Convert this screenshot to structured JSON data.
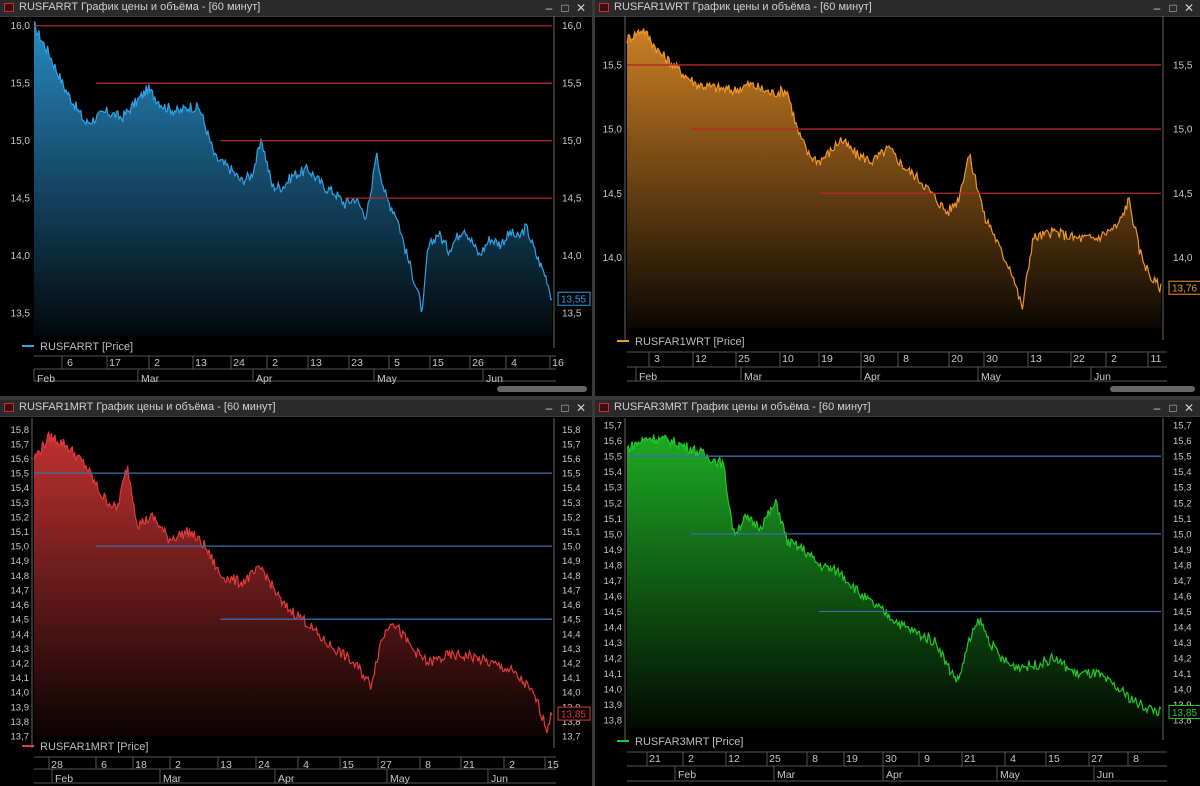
{
  "windows": [
    {
      "title": "RUSFARRT График цены и объёма - [60 минут]",
      "legend": "RUSFARRT [Price]",
      "color": "#2ea3e6",
      "last_label": "13,55",
      "chart_data": {
        "type": "area",
        "ylim": [
          13.3,
          16.05
        ],
        "y_ticks": [
          "13,5",
          "14,0",
          "14,5",
          "15,0",
          "15,5",
          "16,0"
        ],
        "y_tick_values": [
          13.5,
          14.0,
          14.5,
          15.0,
          15.5,
          16.0
        ],
        "x": [
          0,
          0.03,
          0.06,
          0.1,
          0.14,
          0.17,
          0.2,
          0.22,
          0.25,
          0.28,
          0.3,
          0.32,
          0.35,
          0.38,
          0.4,
          0.42,
          0.44,
          0.46,
          0.48,
          0.5,
          0.53,
          0.56,
          0.58,
          0.6,
          0.62,
          0.64,
          0.65,
          0.66,
          0.68,
          0.7,
          0.72,
          0.74,
          0.75,
          0.76,
          0.78,
          0.8,
          0.83,
          0.86,
          0.88,
          0.9,
          0.92,
          0.935,
          0.95,
          0.97,
          0.99,
          1
        ],
        "values": [
          16.0,
          15.75,
          15.45,
          15.15,
          15.25,
          15.2,
          15.35,
          15.45,
          15.3,
          15.25,
          15.3,
          15.28,
          14.85,
          14.75,
          14.65,
          14.7,
          15.0,
          14.6,
          14.6,
          14.7,
          14.75,
          14.6,
          14.55,
          14.45,
          14.5,
          14.35,
          14.5,
          14.9,
          14.5,
          14.35,
          14.0,
          13.7,
          13.5,
          14.05,
          14.2,
          14.05,
          14.25,
          14.0,
          14.15,
          14.1,
          14.2,
          14.15,
          14.25,
          14.0,
          13.8,
          13.62
        ],
        "ref_lines": [
          16.0,
          15.5,
          15.0,
          14.5
        ],
        "ref_color": "#b52828",
        "x_ticks_top": [
          "6",
          "17",
          "2",
          "13",
          "24",
          "2",
          "13",
          "23",
          "5",
          "15",
          "26",
          "4",
          "16"
        ],
        "x_ticks_bottom": [
          "Feb",
          "Mar",
          "Apr",
          "May",
          "Jun"
        ]
      }
    },
    {
      "title": "RUSFAR1WRT График цены и объёма - [60 минут]",
      "legend": "RUSFAR1WRT [Price]",
      "color": "#f0962a",
      "last_label": "13,76",
      "chart_data": {
        "type": "area",
        "ylim": [
          13.45,
          15.85
        ],
        "y_ticks": [
          "14,0",
          "14,5",
          "15,0",
          "15,5"
        ],
        "y_tick_values": [
          14.0,
          14.5,
          15.0,
          15.5
        ],
        "x": [
          0,
          0.03,
          0.06,
          0.1,
          0.13,
          0.17,
          0.2,
          0.23,
          0.27,
          0.3,
          0.32,
          0.34,
          0.36,
          0.38,
          0.4,
          0.43,
          0.46,
          0.49,
          0.52,
          0.55,
          0.58,
          0.6,
          0.62,
          0.64,
          0.66,
          0.67,
          0.68,
          0.7,
          0.72,
          0.74,
          0.76,
          0.8,
          0.84,
          0.88,
          0.9,
          0.92,
          0.94,
          0.96,
          0.98,
          1
        ],
        "values": [
          15.7,
          15.78,
          15.6,
          15.45,
          15.35,
          15.32,
          15.3,
          15.35,
          15.28,
          15.3,
          14.98,
          14.8,
          14.75,
          14.82,
          14.92,
          14.8,
          14.75,
          14.85,
          14.7,
          14.6,
          14.45,
          14.35,
          14.45,
          14.8,
          14.5,
          14.3,
          14.25,
          14.05,
          13.9,
          13.6,
          14.15,
          14.2,
          14.15,
          14.15,
          14.2,
          14.25,
          14.45,
          14.05,
          13.85,
          13.76
        ],
        "ref_lines": [
          15.5,
          15.0,
          14.5
        ],
        "ref_color": "#b52828",
        "x_ticks_top": [
          "3",
          "12",
          "25",
          "10",
          "19",
          "30",
          "8",
          "20",
          "30",
          "13",
          "22",
          "2",
          "11"
        ],
        "x_ticks_bottom": [
          "Feb",
          "Mar",
          "Apr",
          "May",
          "Jun"
        ]
      }
    },
    {
      "title": "RUSFAR1MRT График цены и объёма - [60 минут]",
      "legend": "RUSFAR1MRT [Price]",
      "color": "#e23a3a",
      "last_label": "13,85",
      "chart_data": {
        "type": "area",
        "ylim": [
          13.7,
          15.85
        ],
        "y_ticks": [
          "13,7",
          "13,8",
          "13,9",
          "14,0",
          "14,1",
          "14,2",
          "14,3",
          "14,4",
          "14,5",
          "14,6",
          "14,7",
          "14,8",
          "14,9",
          "15,0",
          "15,1",
          "15,2",
          "15,3",
          "15,4",
          "15,5",
          "15,6",
          "15,7",
          "15,8"
        ],
        "y_tick_values": [
          13.7,
          13.8,
          13.9,
          14.0,
          14.1,
          14.2,
          14.3,
          14.4,
          14.5,
          14.6,
          14.7,
          14.8,
          14.9,
          15.0,
          15.1,
          15.2,
          15.3,
          15.4,
          15.5,
          15.6,
          15.7,
          15.8
        ],
        "x": [
          0,
          0.03,
          0.06,
          0.1,
          0.13,
          0.16,
          0.18,
          0.2,
          0.23,
          0.26,
          0.3,
          0.33,
          0.36,
          0.4,
          0.44,
          0.48,
          0.52,
          0.56,
          0.6,
          0.63,
          0.65,
          0.67,
          0.69,
          0.71,
          0.73,
          0.76,
          0.8,
          0.84,
          0.88,
          0.92,
          0.95,
          0.97,
          0.99,
          1
        ],
        "values": [
          15.6,
          15.75,
          15.7,
          15.55,
          15.35,
          15.25,
          15.55,
          15.15,
          15.2,
          15.05,
          15.1,
          15.0,
          14.8,
          14.75,
          14.85,
          14.6,
          14.5,
          14.35,
          14.25,
          14.15,
          14.05,
          14.35,
          14.5,
          14.4,
          14.3,
          14.2,
          14.25,
          14.25,
          14.2,
          14.15,
          14.05,
          13.95,
          13.75,
          13.85
        ],
        "ref_lines": [
          15.5,
          15.0,
          14.5
        ],
        "ref_color": "#3a6ea8",
        "x_ticks_top": [
          "28",
          "6",
          "18",
          "2",
          "13",
          "24",
          "4",
          "15",
          "27",
          "8",
          "21",
          "2",
          "15"
        ],
        "x_ticks_bottom": [
          "Feb",
          "Mar",
          "Apr",
          "May",
          "Jun"
        ]
      }
    },
    {
      "title": "RUSFAR3MRT График цены и объёма - [60 минут]",
      "legend": "RUSFAR3MRT [Price]",
      "color": "#23c92a",
      "last_label": "13,85",
      "chart_data": {
        "type": "area",
        "ylim": [
          13.75,
          15.72
        ],
        "y_ticks": [
          "13,8",
          "13,9",
          "14,0",
          "14,1",
          "14,2",
          "14,3",
          "14,4",
          "14,5",
          "14,6",
          "14,7",
          "14,8",
          "14,9",
          "15,0",
          "15,1",
          "15,2",
          "15,3",
          "15,4",
          "15,5",
          "15,6",
          "15,7"
        ],
        "y_tick_values": [
          13.8,
          13.9,
          14.0,
          14.1,
          14.2,
          14.3,
          14.4,
          14.5,
          14.6,
          14.7,
          14.8,
          14.9,
          15.0,
          15.1,
          15.2,
          15.3,
          15.4,
          15.5,
          15.6,
          15.7
        ],
        "x": [
          0,
          0.04,
          0.08,
          0.12,
          0.15,
          0.18,
          0.2,
          0.22,
          0.25,
          0.28,
          0.3,
          0.33,
          0.36,
          0.4,
          0.44,
          0.48,
          0.52,
          0.55,
          0.58,
          0.6,
          0.62,
          0.64,
          0.66,
          0.68,
          0.7,
          0.72,
          0.76,
          0.8,
          0.84,
          0.88,
          0.92,
          0.96,
          1
        ],
        "values": [
          15.55,
          15.62,
          15.6,
          15.55,
          15.5,
          15.45,
          15.0,
          15.1,
          15.05,
          15.2,
          14.95,
          14.9,
          14.8,
          14.75,
          14.6,
          14.5,
          14.4,
          14.35,
          14.3,
          14.15,
          14.05,
          14.3,
          14.45,
          14.3,
          14.2,
          14.15,
          14.15,
          14.2,
          14.1,
          14.1,
          14.0,
          13.9,
          13.85
        ],
        "ref_lines": [
          15.5,
          15.0,
          14.5
        ],
        "ref_color": "#3a6ea8",
        "x_ticks_top": [
          "21",
          "2",
          "12",
          "25",
          "8",
          "19",
          "30",
          "9",
          "21",
          "4",
          "15",
          "27",
          "8"
        ],
        "x_ticks_bottom": [
          "Feb",
          "Mar",
          "Apr",
          "May",
          "Jun"
        ]
      }
    }
  ]
}
